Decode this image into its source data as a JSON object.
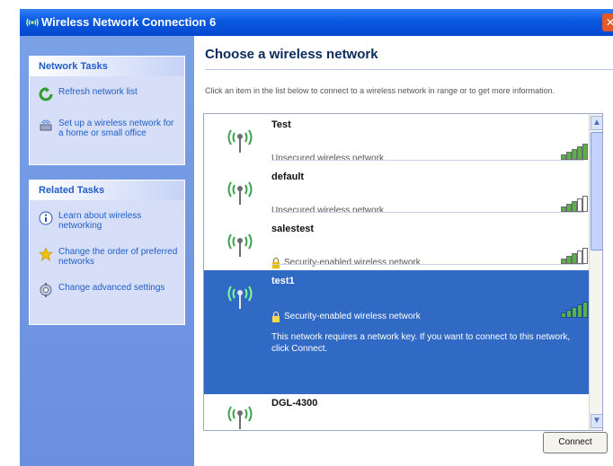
{
  "window": {
    "title": "Wireless Network Connection 6",
    "close_glyph": "✕"
  },
  "left_pane": {
    "network_tasks": {
      "header": "Network Tasks",
      "items": [
        {
          "label": "Refresh network list",
          "icon": "refresh-icon"
        },
        {
          "label": "Set up a wireless network for a home or small office",
          "icon": "setup-wireless-icon"
        }
      ]
    },
    "related_tasks": {
      "header": "Related Tasks",
      "items": [
        {
          "label": "Learn about wireless networking",
          "icon": "info-icon"
        },
        {
          "label": "Change the order of preferred networks",
          "icon": "star-icon"
        },
        {
          "label": "Change advanced settings",
          "icon": "settings-icon"
        }
      ]
    }
  },
  "main": {
    "heading": "Choose a wireless network",
    "description": "Click an item in the list below to connect to a wireless network in range or to get more information.",
    "networks": [
      {
        "name": "Test",
        "status": "Unsecured wireless network",
        "signal": 4,
        "secured": false,
        "selected": false
      },
      {
        "name": "default",
        "status": "Unsecured wireless network",
        "signal": 3,
        "secured": false,
        "selected": false
      },
      {
        "name": "salestest",
        "status": "Security-enabled wireless network",
        "signal": 3,
        "secured": true,
        "selected": false
      },
      {
        "name": "test1",
        "status": "Security-enabled wireless network",
        "signal": 4,
        "secured": true,
        "selected": true,
        "message": "This network requires a network key. If you want to connect to this network, click Connect."
      },
      {
        "name": "DGL-4300",
        "status": "",
        "signal": 0,
        "secured": false,
        "selected": false
      }
    ],
    "connect_label": "Connect"
  },
  "colors": {
    "title_bar": "#0a58e0",
    "left_pane": "#6f94e1",
    "selected_row": "#316ac5",
    "signal_bar": "#5bb04a"
  }
}
